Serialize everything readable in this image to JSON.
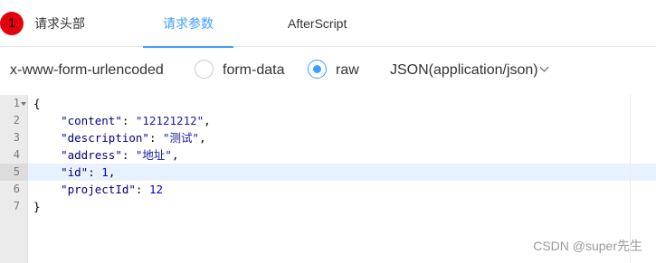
{
  "tabs": {
    "badge": "1",
    "items": [
      "请求头部",
      "请求参数",
      "AfterScript"
    ],
    "active": "请求参数",
    "accent": "#409eff",
    "badge_color": "#e3000f"
  },
  "body_types": {
    "urlencoded": "x-www-form-urlencoded",
    "form_data": "form-data",
    "raw": "raw",
    "selected": "raw",
    "raw_format": "JSON(application/json)"
  },
  "editor": {
    "line_numbers": [
      "1",
      "2",
      "3",
      "4",
      "5",
      "6",
      "7"
    ],
    "highlighted_line": 5,
    "lines": {
      "l1": {
        "brace": "{"
      },
      "l2": {
        "indent": "    ",
        "key": "\"content\"",
        "sep": ": ",
        "value": "\"12121212\"",
        "end": ","
      },
      "l3": {
        "indent": "    ",
        "key": "\"description\"",
        "sep": ": ",
        "value": "\"测试\"",
        "end": ","
      },
      "l4": {
        "indent": "    ",
        "key": "\"address\"",
        "sep": ": ",
        "value": "\"地址\"",
        "end": ","
      },
      "l5": {
        "indent": "    ",
        "key": "\"id\"",
        "sep": ": ",
        "value": "1",
        "end": ","
      },
      "l6": {
        "indent": "    ",
        "key": "\"projectId\"",
        "sep": ": ",
        "value": "12",
        "end": ""
      },
      "l7": {
        "brace": "}"
      }
    }
  },
  "watermark": "CSDN @super先生"
}
